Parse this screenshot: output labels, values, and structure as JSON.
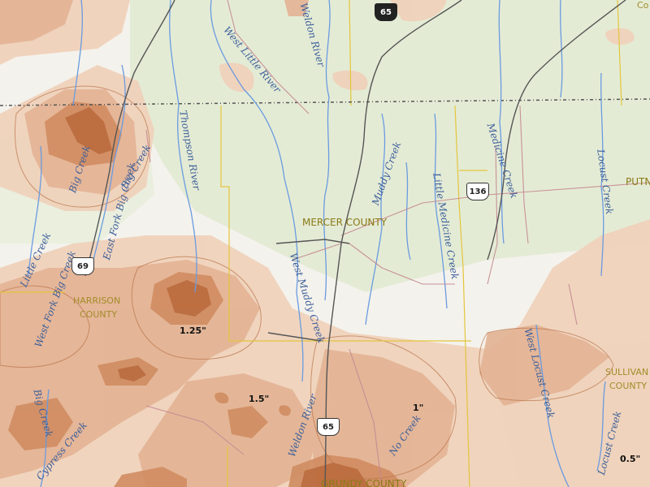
{
  "colors": {
    "land": "#f4f2ec",
    "vegetation": "#d7e6c2",
    "water": "#6a9be0",
    "road": "#c48891",
    "highway": "#555555",
    "county_line": "#e3c53c",
    "state_line": "#555555",
    "precip_light": "#f0d0b9",
    "precip_mid": "#dca684",
    "precip_heavy": "#c67b4f",
    "precip_max": "#9e4f22"
  },
  "county_labels": {
    "mercer": "MERCER COUNTY",
    "harrison_1": "HARRISON",
    "harrison_2": "COUNTY",
    "sullivan_1": "SULLIVAN",
    "sullivan_2": "COUNTY",
    "putnam_partial": "PUTN",
    "grundy_partial": "GRUNDY COUNTY",
    "top_right_partial": "Co"
  },
  "rivers": {
    "weldon_river_top": "Weldon River",
    "west_little_river": "West Little River",
    "thompson_river": "Thompson River",
    "muddy_creek": "Muddy Creek",
    "little_medicine_creek": "Little Medicine Creek",
    "medicine_creek": "Medicine Creek",
    "locust_creek": "Locust Creek",
    "west_muddy_creek": "West Muddy Creek",
    "east_fork_big_creek": "East Fork Big Creek",
    "west_fork_big_creek": "West Fork Big Creek",
    "big_creek_a": "Big Creek",
    "big_creek_b": "Big Creek",
    "big_creek_c": "Big Creek",
    "little_creek": "Little Creek",
    "west_locust_creek": "West Locust Creek",
    "locust_creek_lower": "Locust Creek",
    "weldon_river_lower": "Weldon River",
    "no_creek": "No Creek",
    "cypress_creek": "Cypress Creek"
  },
  "highways": {
    "us65_top": "65",
    "us69": "69",
    "us136": "136",
    "us65_lower": "65"
  },
  "contour_labels": {
    "c125": "1.25\"",
    "c15": "1.5\"",
    "c1": "1\"",
    "c05": "0.5\""
  }
}
